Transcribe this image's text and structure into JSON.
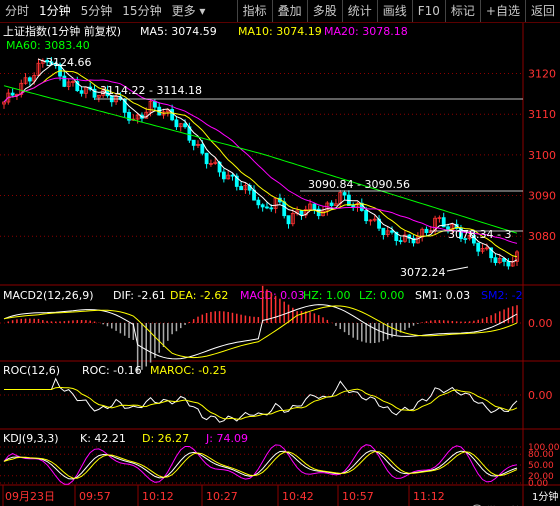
{
  "toolbar": {
    "left_tabs": [
      "分时",
      "1分钟",
      "5分钟",
      "15分钟",
      "更多"
    ],
    "active_tab": "1分钟",
    "right_buttons": [
      "指标",
      "叠加",
      "多股",
      "统计",
      "画线",
      "F10",
      "标记",
      "+自选",
      "返回"
    ]
  },
  "main_panel": {
    "title": "上证指数(1分钟 前复权)",
    "ma_labels": [
      {
        "label": "MA5: 3074.59",
        "color": "#ffffff"
      },
      {
        "label": "MA10: 3074.19",
        "color": "#ffff00"
      },
      {
        "label": "MA20: 3078.18",
        "color": "#ff00ff"
      },
      {
        "label": "MA60: 3083.40",
        "color": "#00ff00"
      }
    ],
    "y_ticks": [
      "3120",
      "3110",
      "3100",
      "3090",
      "3080"
    ],
    "annotations": [
      "3124.66",
      "3114.22 - 3114.18",
      "3090.84 - 3090.56",
      "3078.34 - 3",
      "3072.24"
    ]
  },
  "macd_panel": {
    "title": "MACD2(12,26,9)",
    "values": [
      {
        "label": "DIF: -2.61",
        "color": "#ffffff"
      },
      {
        "label": "DEA: -2.62",
        "color": "#ffff00"
      },
      {
        "label": "MACD: 0.03",
        "color": "#ff00ff"
      },
      {
        "label": "HZ: 1.00",
        "color": "#00ff00"
      },
      {
        "label": "LZ: 0.00",
        "color": "#00ff00"
      },
      {
        "label": "SM1: 0.03",
        "color": "#ffffff"
      },
      {
        "label": "SM2: -2",
        "color": "#0000ff"
      }
    ],
    "y_tick": "0.00"
  },
  "roc_panel": {
    "title": "ROC(12,6)",
    "values": [
      {
        "label": "ROC: -0.16",
        "color": "#ffffff"
      },
      {
        "label": "MAROC: -0.25",
        "color": "#ffff00"
      }
    ],
    "y_tick": "0.00"
  },
  "kdj_panel": {
    "title": "KDJ(9,3,3)",
    "values": [
      {
        "label": "K: 42.21",
        "color": "#ffffff"
      },
      {
        "label": "D: 26.27",
        "color": "#ffff00"
      },
      {
        "label": "J: 74.09",
        "color": "#ff00ff"
      }
    ],
    "y_ticks": [
      "100.00",
      "80.00",
      "50.00",
      "20.00",
      "0.00"
    ]
  },
  "time_axis": [
    "09月23日",
    "09:57",
    "10:12",
    "10:27",
    "10:42",
    "10:57",
    "11:12"
  ],
  "time_axis_unit": "1分钟",
  "watermark": "微Wi笑",
  "colors": {
    "up": "#ff3232",
    "down": "#00ffff",
    "grid": "#8b0000",
    "background": "#000000"
  }
}
